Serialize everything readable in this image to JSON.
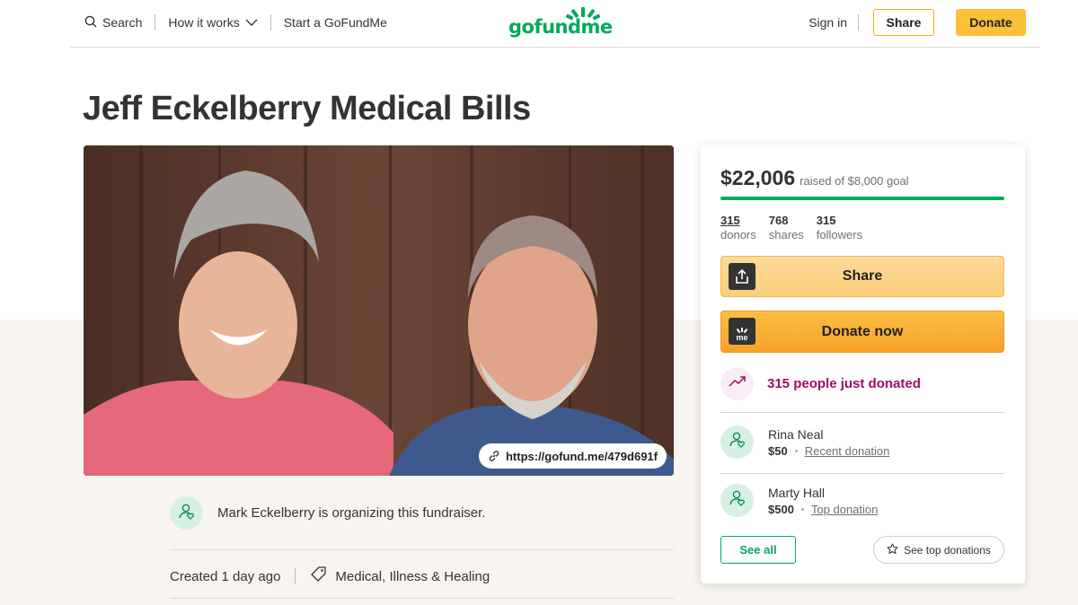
{
  "header": {
    "search_label": "Search",
    "how_it_works_label": "How it works",
    "start_label": "Start a GoFundMe",
    "logo_text": "gofundme",
    "signin_label": "Sign in",
    "share_label": "Share",
    "donate_label": "Donate"
  },
  "campaign": {
    "title": "Jeff Eckelberry Medical Bills",
    "short_url": "https://gofund.me/479d691f",
    "organizer_text": "Mark Eckelberry is organizing this fundraiser.",
    "created_text": "Created 1 day ago",
    "category": "Medical, Illness & Healing"
  },
  "card": {
    "raised": "$22,006",
    "goal_text": "raised of $8,000 goal",
    "progress_fraction": 1.0,
    "stats": [
      {
        "num": "315",
        "label": "donors"
      },
      {
        "num": "768",
        "label": "shares"
      },
      {
        "num": "315",
        "label": "followers"
      }
    ],
    "share_label": "Share",
    "donate_now_label": "Donate now",
    "donate_icon_text": "me",
    "trend_text": "315 people just donated",
    "donations": [
      {
        "name": "Rina Neal",
        "amount": "$50",
        "tag": "Recent donation"
      },
      {
        "name": "Marty Hall",
        "amount": "$500",
        "tag": "Top donation"
      }
    ],
    "see_all_label": "See all",
    "see_top_label": "See top donations"
  },
  "colors": {
    "brand_green": "#02a95c",
    "donate_yellow": "#fbc13a",
    "trend_purple": "#a00b68"
  },
  "icons": [
    "search-icon",
    "chevron-down-icon",
    "logo-sprout-icon",
    "link-icon",
    "user-heart-icon",
    "tag-icon",
    "share-upload-icon",
    "gofundme-me-icon",
    "trend-up-icon",
    "star-icon"
  ]
}
